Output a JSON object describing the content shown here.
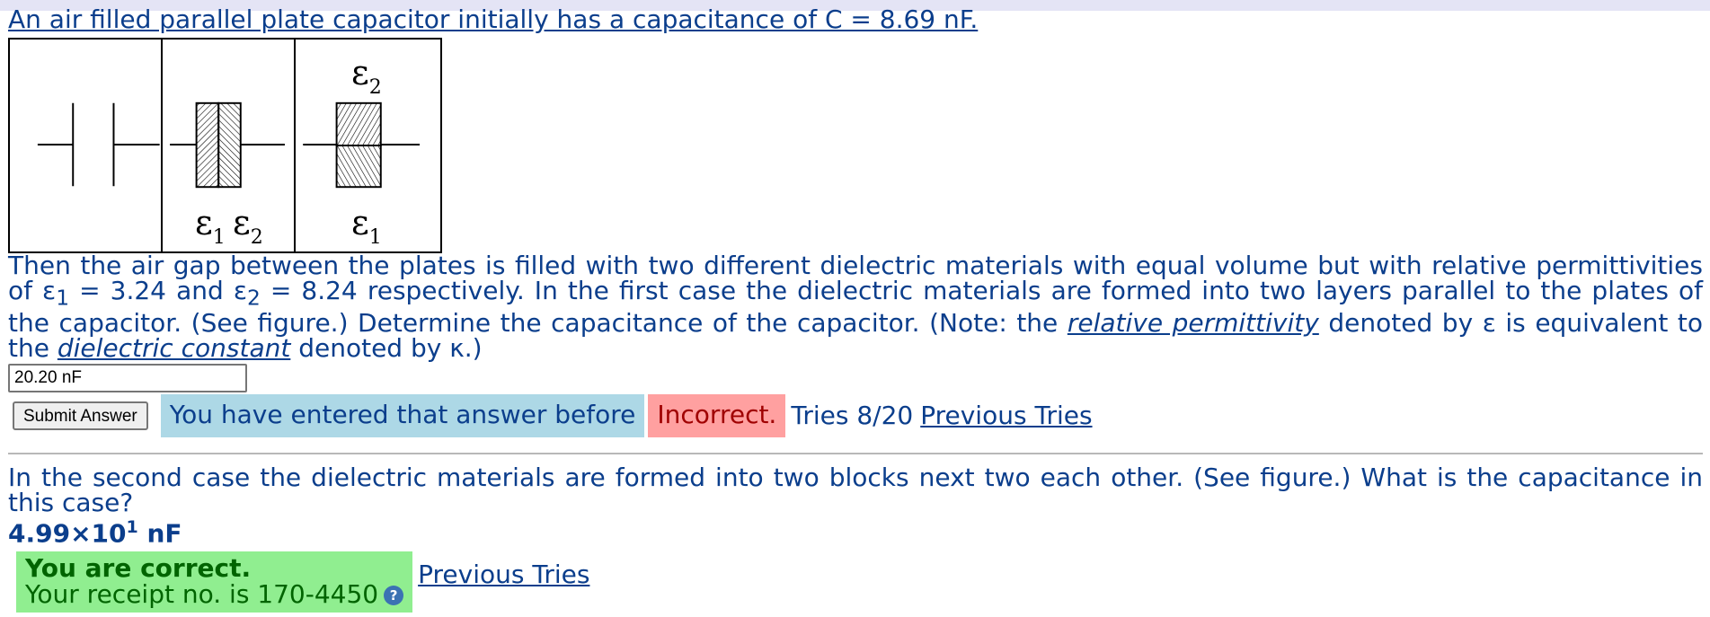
{
  "question1": {
    "intro": "An air filled parallel plate capacitor initially has a capacitance of C = 8.69 nF.",
    "figure": {
      "panel2_label_a": "ε",
      "panel2_label_a_sub": "1",
      "panel2_label_b": "ε",
      "panel2_label_b_sub": "2",
      "panel3_top": "ε",
      "panel3_top_sub": "2",
      "panel3_bottom": "ε",
      "panel3_bottom_sub": "1"
    },
    "body_part1": "Then the air gap between the plates is filled with two different dielectric materials with equal volume but with relative permittivities of ε",
    "sub1": "1",
    "body_part2": " = 3.24 and ε",
    "sub2": "2",
    "body_part3": " = 8.24 respectively. In the first case the dielectric materials are formed into two layers parallel to the plates of the capacitor. (See figure.) Determine the capacitance of the capacitor. (Note: the ",
    "italic1": "relative permittivity",
    "body_part4": " denoted by ε is equivalent to the ",
    "italic2": "dielectric constant",
    "body_part5": " denoted by κ.)",
    "answer_value": "20.20 nF",
    "submit_label": "Submit Answer",
    "msg_repeat": "You have entered that answer before",
    "msg_incorrect": "Incorrect.",
    "tries": "Tries 8/20",
    "previous_tries": "Previous Tries"
  },
  "question2": {
    "text": "In the second case the dielectric materials are formed into two blocks next two each other. (See figure.) What is the capacitance in this case?",
    "answer_mantissa": "4.99×10",
    "answer_exponent": "1",
    "answer_unit": " nF",
    "correct_head": "You are correct.",
    "receipt": "Your receipt no. is 170-4450",
    "help_glyph": "?",
    "previous_tries": "Previous Tries"
  },
  "colors": {
    "text": "#0b3e8c",
    "repeat_bg": "#add8e6",
    "incorrect_bg": "#ffa0a0",
    "correct_bg": "#90ee90"
  },
  "icons": {
    "help": "help-question-icon"
  }
}
